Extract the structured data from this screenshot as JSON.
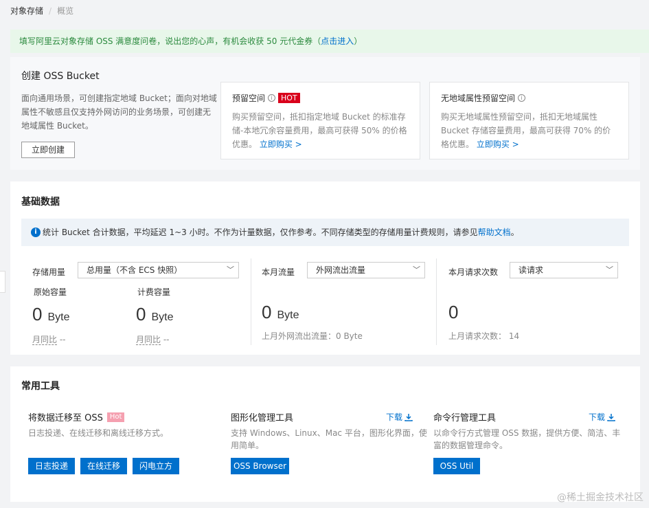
{
  "breadcrumb": {
    "root": "对象存储",
    "sep": "/",
    "current": "概览"
  },
  "notice": {
    "text": "填写阿里云对象存储 OSS 满意度问卷，说出您的心声，有机会收获 50 元代金券（",
    "link": "点击进入",
    "close": "）"
  },
  "create": {
    "title": "创建 OSS Bucket",
    "desc": "面向通用场景，可创建指定地域 Bucket；面向对地域属性不敏感且仅支持外网访问的业务场景，可创建无地域属性 Bucket。",
    "button": "立即创建",
    "promo1": {
      "title": "预留空间",
      "hot": "HOT",
      "text": "购买预留空间，抵扣指定地域 Bucket 的标准存储-本地冗余容量费用，最高可获得 50% 的价格优惠。",
      "link": "立即购买 >"
    },
    "promo2": {
      "title": "无地域属性预留空间",
      "text": "购买无地域属性预留空间，抵扣无地域属性 Bucket 存储容量费用，最高可获得 70% 的价格优惠。",
      "link": "立即购买 >"
    }
  },
  "basic": {
    "title": "基础数据",
    "info": "统计 Bucket 合计数据，平均延迟 1~3 小时。不作为计量数据，仅作参考。不同存储类型的存储用量计费规则，请参见",
    "info_link": "帮助文档",
    "info_end": "。",
    "storage": {
      "label": "存储用量",
      "select": "总用量（不含 ECS 快照）",
      "raw_label": "原始容量",
      "raw_value": "0",
      "raw_unit": "Byte",
      "raw_mom": "月同比",
      "raw_mom_val": "--",
      "bill_label": "计费容量",
      "bill_value": "0",
      "bill_unit": "Byte",
      "bill_mom": "月同比",
      "bill_mom_val": "--"
    },
    "traffic": {
      "label": "本月流量",
      "select": "外网流出流量",
      "value": "0",
      "unit": "Byte",
      "last": "上月外网流出流量：0 Byte"
    },
    "requests": {
      "label": "本月请求次数",
      "select": "读请求",
      "value": "0",
      "last": "上月请求次数：",
      "last_val": "14"
    }
  },
  "tools": {
    "title": "常用工具",
    "migrate": {
      "title": "将数据迁移至 OSS",
      "hot": "Hot",
      "desc": "日志投递、在线迁移和离线迁移方式。",
      "b1": "日志投递",
      "b2": "在线迁移",
      "b3": "闪电立方"
    },
    "gui": {
      "title": "图形化管理工具",
      "download": "下载",
      "desc1": "支持 Windows、Linux、Mac 平台，图形化界面，使",
      "desc2": "用简单。",
      "button": "OSS Browser"
    },
    "cli": {
      "title": "命令行管理工具",
      "download": "下载",
      "desc1": "以命令行方式管理 OSS 数据，提供方便、简洁、丰",
      "desc2": "富的数据管理命令。",
      "button": "OSS Util"
    }
  },
  "watermark": "@稀土掘金技术社区",
  "colors": {
    "primary": "#0070cc",
    "hot": "#d9001b",
    "notice_bg": "#e8f7ea",
    "notice_text": "#2b8a3e"
  }
}
